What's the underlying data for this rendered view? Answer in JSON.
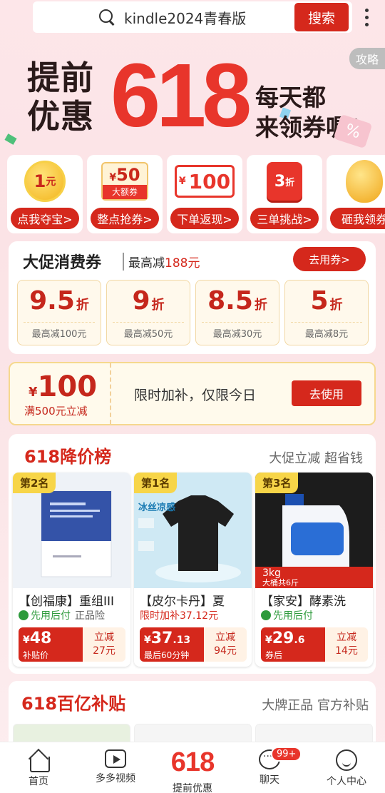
{
  "search": {
    "query": "kindle2024青春版",
    "button": "搜索"
  },
  "banner": {
    "left": "提前优惠",
    "left1": "提前",
    "left2": "优惠",
    "big": "618",
    "right1": "每天都",
    "right2": "来领券喔!",
    "guide": "攻略"
  },
  "quick": [
    {
      "icon": "coin-icon",
      "icon_text": "1",
      "icon_unit": "元",
      "label": "点我夺宝>"
    },
    {
      "icon": "coupon-tag-icon",
      "icon_text": "50",
      "icon_prefix": "¥",
      "icon_sub": "大额券",
      "label": "整点抢券>"
    },
    {
      "icon": "cash-tag-icon",
      "icon_text": "100",
      "icon_prefix": "¥",
      "label": "下单返现>"
    },
    {
      "icon": "discount-tag-icon",
      "icon_text": "3",
      "icon_unit": "折",
      "label": "三单挑战>"
    },
    {
      "icon": "golden-egg-icon",
      "label": "砸我领券"
    }
  ],
  "coupons": {
    "title": "大促消费券",
    "sub_prefix": "最高减",
    "sub_value": "188元",
    "use_button": "去用券>",
    "items": [
      {
        "value": "9.5",
        "unit": "折",
        "desc": "最高减100元"
      },
      {
        "value": "9",
        "unit": "折",
        "desc": "最高减50元"
      },
      {
        "value": "8.5",
        "unit": "折",
        "desc": "最高减30元"
      },
      {
        "value": "5",
        "unit": "折",
        "desc": "最高减8元"
      }
    ]
  },
  "bonus": {
    "currency": "¥",
    "amount": "100",
    "condition": "满500元立减",
    "text": "限时加补，仅限今日",
    "button": "去使用"
  },
  "rank": {
    "title": "618降价榜",
    "subtitle": "大促立减 超省钱",
    "items": [
      {
        "badge": "第2名",
        "name": "【创福康】重组III",
        "note_green": "先用后付",
        "note_gray": "正品险",
        "currency": "¥",
        "price": "48",
        "price_sub": "补贴价",
        "cut_label": "立减",
        "cut": "27元"
      },
      {
        "badge": "第1名",
        "name": "【皮尔卡丹】夏",
        "note_red": "限时加补37.12元",
        "currency": "¥",
        "price": "37",
        "price_dec": ".13",
        "price_sub": "最后60分钟",
        "cut_label": "立减",
        "cut": "94元"
      },
      {
        "badge": "第3名",
        "name": "【家安】酵素洗",
        "note_green": "先用后付",
        "currency": "¥",
        "price": "29",
        "price_dec": ".6",
        "price_sub": "券后",
        "cut_label": "立减",
        "cut": "14元"
      }
    ],
    "image_texts": {
      "tshirt_tag": "冰丝凉感",
      "detergent_weight": "3kg",
      "detergent_note": "大桶共6斤"
    }
  },
  "subsidy": {
    "title": "618百亿补贴",
    "subtitle": "大牌正品 官方补贴"
  },
  "nav": [
    {
      "icon": "home-icon",
      "label": "首页"
    },
    {
      "icon": "video-icon",
      "label": "多多视频"
    },
    {
      "icon": "promo-618-icon",
      "big": "618",
      "label": "提前优惠"
    },
    {
      "icon": "chat-icon",
      "label": "聊天",
      "badge": "99+"
    },
    {
      "icon": "profile-icon",
      "label": "个人中心"
    }
  ],
  "colors": {
    "accent": "#d5281c",
    "banner_red": "#e8352b",
    "coupon_bg": "#fff9ec",
    "background": "#fbe3e6"
  }
}
